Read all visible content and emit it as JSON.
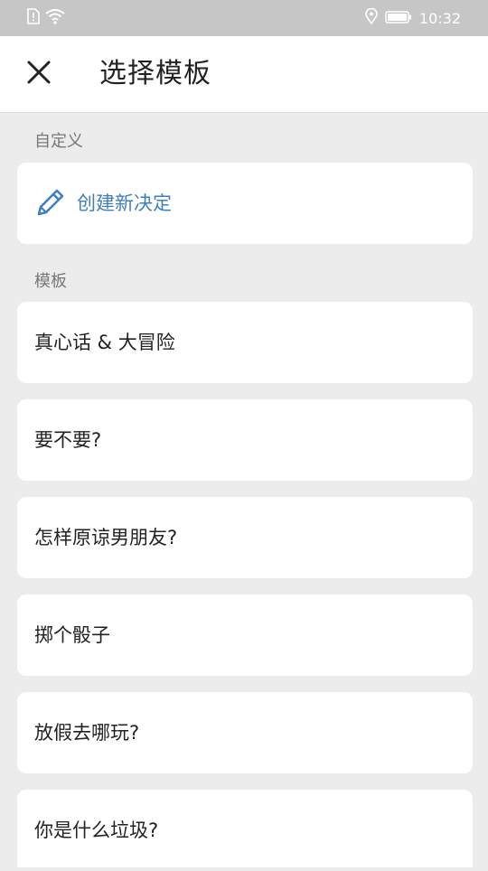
{
  "status_bar": {
    "time": "10:32",
    "icons": [
      "sim-alert-icon",
      "wifi-icon",
      "location-icon",
      "battery-icon"
    ]
  },
  "app_bar": {
    "close_icon": "close-icon",
    "title": "选择模板"
  },
  "custom_section": {
    "label": "自定义",
    "create_label": "创建新决定",
    "create_icon": "pencil-icon"
  },
  "template_section": {
    "label": "模板",
    "items": [
      {
        "label": "真心话 & 大冒险"
      },
      {
        "label": "要不要?"
      },
      {
        "label": "怎样原谅男朋友?"
      },
      {
        "label": "掷个骰子"
      },
      {
        "label": "放假去哪玩?"
      },
      {
        "label": "你是什么垃圾?"
      }
    ]
  },
  "colors": {
    "accent": "#3f7fbf",
    "background": "#ececec",
    "card": "#ffffff",
    "status_bar": "#c6c6c6"
  }
}
